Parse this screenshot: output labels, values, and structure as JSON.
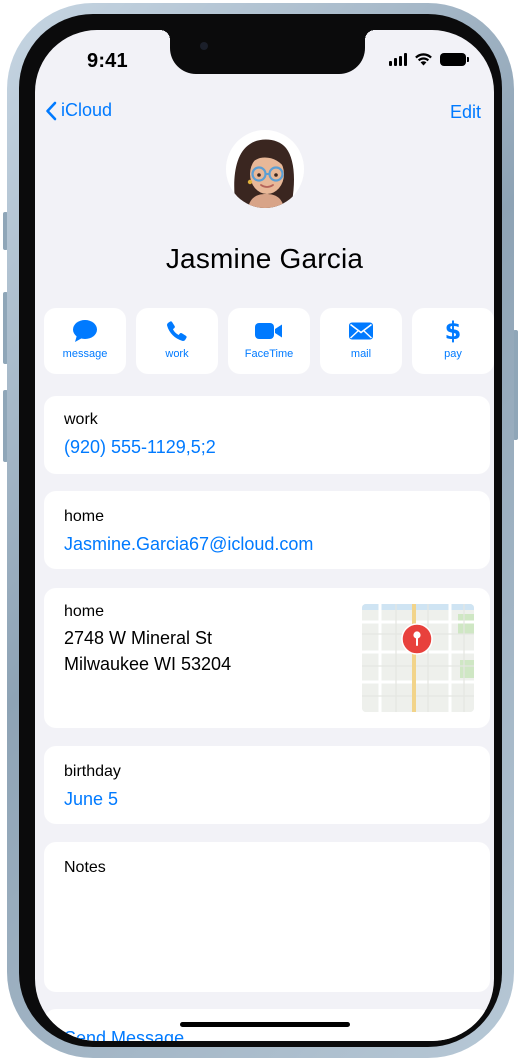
{
  "status_bar": {
    "time": "9:41"
  },
  "nav": {
    "back_label": "iCloud",
    "edit_label": "Edit"
  },
  "contact": {
    "name": "Jasmine Garcia"
  },
  "actions": [
    {
      "label": "message",
      "icon": "message-bubble-icon"
    },
    {
      "label": "work",
      "icon": "phone-icon"
    },
    {
      "label": "FaceTime",
      "icon": "video-camera-icon"
    },
    {
      "label": "mail",
      "icon": "envelope-icon"
    },
    {
      "label": "pay",
      "icon": "dollar-sign-icon",
      "glyph": "$"
    }
  ],
  "phone": {
    "label": "work",
    "value": "(920) 555-1129,5;2"
  },
  "email": {
    "label": "home",
    "value": "Jasmine.Garcia67@icloud.com"
  },
  "address": {
    "label": "home",
    "line1": "2748 W Mineral St",
    "line2": "Milwaukee WI 53204"
  },
  "birthday": {
    "label": "birthday",
    "value": "June 5"
  },
  "notes": {
    "label": "Notes"
  },
  "send_message": {
    "label": "Send Message"
  },
  "colors": {
    "accent": "#007aff",
    "background": "#f2f2f7",
    "card": "#ffffff",
    "map_pin": "#e8413c"
  }
}
